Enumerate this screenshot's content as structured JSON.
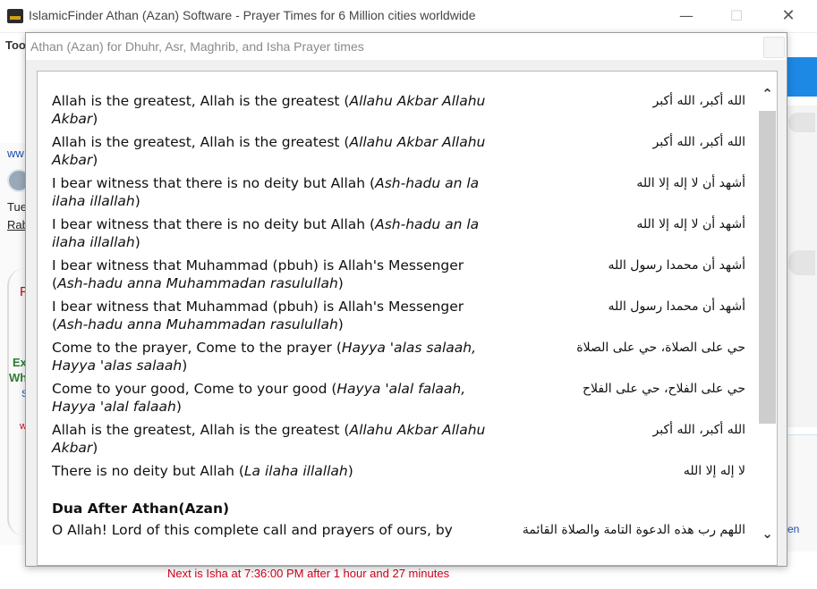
{
  "main_window": {
    "title": "IslamicFinder Athan (Azan) Software - Prayer Times for 6 Million cities worldwide",
    "minimize_glyph": "—",
    "maximize_glyph": "☐",
    "close_glyph": "✕"
  },
  "background": {
    "toolbar_label": "Too",
    "left_fragments": [
      "ww",
      "Tue",
      "Rab",
      "P",
      "Ex",
      "Wh",
      "S",
      "w"
    ],
    "right_link": "en"
  },
  "status": {
    "next_prayer": "Next is Isha at 7:36:00 PM after 1 hour and 27 minutes",
    "color": "#d0021b"
  },
  "dialog": {
    "title": "Athan (Azan) for Dhuhr, Asr, Maghrib, and Isha Prayer times",
    "close_glyph": "✕"
  },
  "athan_lines": [
    {
      "english": "Allah is the greatest, Allah is the greatest",
      "transliteration": "Allahu Akbar Allahu Akbar",
      "arabic": "الله أكبر، الله أكبر"
    },
    {
      "english": "Allah is the greatest, Allah is the greatest",
      "transliteration": "Allahu Akbar Allahu Akbar",
      "arabic": "الله أكبر، الله أكبر"
    },
    {
      "english": "I bear witness that there is no deity but Allah",
      "transliteration": "Ash-hadu an la ilaha illallah",
      "arabic": "أشهد أن لا إله إلا الله"
    },
    {
      "english": "I bear witness that there is no deity but Allah",
      "transliteration": "Ash-hadu an la ilaha illallah",
      "arabic": "أشهد أن لا إله إلا الله"
    },
    {
      "english": "I bear witness that Muhammad (pbuh) is Allah's Messenger",
      "transliteration": "Ash-hadu anna Muhammadan rasulullah",
      "arabic": "أشهد أن محمدا رسول الله"
    },
    {
      "english": "I bear witness that Muhammad (pbuh) is Allah's Messenger",
      "transliteration": "Ash-hadu anna Muhammadan rasulullah",
      "arabic": "أشهد أن محمدا رسول الله"
    },
    {
      "english": "Come to the prayer, Come to the prayer",
      "transliteration": "Hayya 'alas salaah, Hayya 'alas salaah",
      "arabic": "حي على الصلاة، حي على الصلاة"
    },
    {
      "english": "Come to your good, Come to your good",
      "transliteration": "Hayya 'alal falaah, Hayya 'alal falaah",
      "arabic": "حي على الفلاح، حي على الفلاح"
    },
    {
      "english": "Allah is the greatest, Allah is the greatest",
      "transliteration": "Allahu Akbar Allahu Akbar",
      "arabic": "الله أكبر، الله أكبر"
    },
    {
      "english": "There is no deity but Allah",
      "transliteration": "La ilaha illallah",
      "arabic": "لا إله إلا الله"
    }
  ],
  "dua_section": {
    "heading": "Dua After Athan(Azan)",
    "first_line": {
      "english": "O Allah! Lord of this complete call and prayers of ours, by",
      "arabic": "اللهم رب هذه الدعوة التامة والصلاة القائمة"
    }
  },
  "scrollbar": {
    "up_glyph": "⌃",
    "down_glyph": "⌄",
    "position_fraction": 0.0,
    "visible_fraction": 0.76
  }
}
